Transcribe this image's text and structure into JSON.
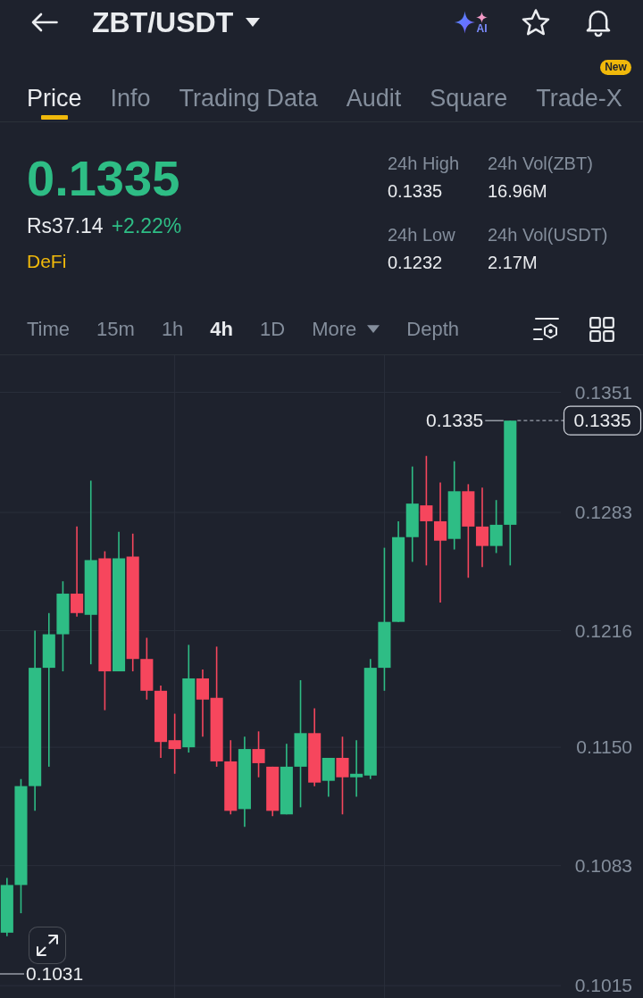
{
  "header": {
    "title": "ZBT/USDT",
    "ai_label": "AI"
  },
  "tabs": [
    {
      "label": "Price",
      "selected": true
    },
    {
      "label": "Info",
      "selected": false
    },
    {
      "label": "Trading Data",
      "selected": false
    },
    {
      "label": "Audit",
      "selected": false
    },
    {
      "label": "Square",
      "selected": false
    },
    {
      "label": "Trade-X",
      "selected": false,
      "badge": "New"
    }
  ],
  "ticker": {
    "price": "0.1335",
    "fiat_price": "Rs37.14",
    "change": "+2.22%",
    "tag": "DeFi",
    "stats": [
      {
        "label": "24h High",
        "value": "0.1335"
      },
      {
        "label": "24h Vol(ZBT)",
        "value": "16.96M"
      },
      {
        "label": "24h Low",
        "value": "0.1232"
      },
      {
        "label": "24h Vol(USDT)",
        "value": "2.17M"
      }
    ]
  },
  "intervals": [
    {
      "label": "Time",
      "kind": "option",
      "selected": false
    },
    {
      "label": "15m",
      "kind": "option",
      "selected": false
    },
    {
      "label": "1h",
      "kind": "option",
      "selected": false
    },
    {
      "label": "4h",
      "kind": "option",
      "selected": true
    },
    {
      "label": "1D",
      "kind": "option",
      "selected": false
    },
    {
      "label": "More",
      "kind": "dropdown",
      "selected": false
    },
    {
      "label": "Depth",
      "kind": "option",
      "selected": false
    }
  ],
  "chart": {
    "chart_data": {
      "type": "candlestick",
      "categories": [
        null,
        null,
        null,
        null,
        null,
        null,
        null,
        null,
        null,
        null,
        null,
        null,
        null,
        null,
        null,
        null,
        null,
        null,
        null,
        null,
        null,
        null,
        null,
        null,
        null,
        null,
        null,
        null,
        null,
        null,
        null,
        null,
        null,
        null,
        null,
        null,
        null,
        null,
        null,
        null,
        null,
        null,
        null,
        null,
        null,
        null
      ],
      "ohlc": [
        [
          0.1045,
          0.1076,
          0.1043,
          0.1072
        ],
        [
          0.1072,
          0.1132,
          0.1056,
          0.1128
        ],
        [
          0.1128,
          0.1216,
          0.1114,
          0.1195
        ],
        [
          0.1195,
          0.1226,
          0.1139,
          0.1214
        ],
        [
          0.1214,
          0.1244,
          0.1193,
          0.1237
        ],
        [
          0.1237,
          0.1275,
          0.1224,
          0.1226
        ],
        [
          0.1225,
          0.1301,
          0.1197,
          0.1256
        ],
        [
          0.1257,
          0.1261,
          0.1171,
          0.1193
        ],
        [
          0.1193,
          0.1272,
          0.1193,
          0.1257
        ],
        [
          0.1258,
          0.1271,
          0.1193,
          0.12
        ],
        [
          0.12,
          0.1212,
          0.1177,
          0.1182
        ],
        [
          0.1182,
          0.1185,
          0.1144,
          0.1153
        ],
        [
          0.1154,
          0.1169,
          0.1135,
          0.1149
        ],
        [
          0.115,
          0.1208,
          0.1147,
          0.1189
        ],
        [
          0.1189,
          0.1194,
          0.1156,
          0.1177
        ],
        [
          0.1178,
          0.1207,
          0.1139,
          0.1142
        ],
        [
          0.1142,
          0.1154,
          0.1112,
          0.1114
        ],
        [
          0.1115,
          0.1156,
          0.1105,
          0.1149
        ],
        [
          0.1149,
          0.1159,
          0.1133,
          0.1141
        ],
        [
          0.1139,
          0.1139,
          0.1111,
          0.1114
        ],
        [
          0.1112,
          0.1152,
          0.1112,
          0.1139
        ],
        [
          0.1139,
          0.1188,
          0.1116,
          0.1158
        ],
        [
          0.1158,
          0.1172,
          0.1128,
          0.113
        ],
        [
          0.1131,
          0.1144,
          0.1122,
          0.1144
        ],
        [
          0.1144,
          0.1156,
          0.1112,
          0.1133
        ],
        [
          0.1133,
          0.1154,
          0.1122,
          0.1135
        ],
        [
          0.1134,
          0.12,
          0.1132,
          0.1195
        ],
        [
          0.1195,
          0.1263,
          0.1182,
          0.1221
        ],
        [
          0.1221,
          0.1278,
          0.1221,
          0.1269
        ],
        [
          0.1269,
          0.1309,
          0.1255,
          0.1288
        ],
        [
          0.1287,
          0.1315,
          0.1253,
          0.1278
        ],
        [
          0.1278,
          0.13,
          0.1232,
          0.1267
        ],
        [
          0.1268,
          0.1312,
          0.1262,
          0.1295
        ],
        [
          0.1295,
          0.1299,
          0.1246,
          0.1275
        ],
        [
          0.1275,
          0.1297,
          0.1252,
          0.1264
        ],
        [
          0.1264,
          0.129,
          0.126,
          0.1276
        ],
        [
          0.1276,
          0.1335,
          0.1253,
          0.1335
        ],
        null,
        null,
        null,
        null,
        null,
        null,
        null,
        null,
        null
      ],
      "ylim": [
        0.1008,
        0.1372
      ],
      "yticks": [
        {
          "value": 0.1351,
          "label": "0.1351"
        },
        {
          "value": 0.1283,
          "label": "0.1283"
        },
        {
          "value": 0.1216,
          "label": "0.1216"
        },
        {
          "value": 0.115,
          "label": "0.1150"
        },
        {
          "value": 0.1083,
          "label": "0.1083"
        },
        {
          "value": 0.1015,
          "label": "0.1015"
        }
      ],
      "grid": true
    },
    "high_label": "0.1335",
    "low_label": "0.1031",
    "last_price": "0.1335"
  }
}
